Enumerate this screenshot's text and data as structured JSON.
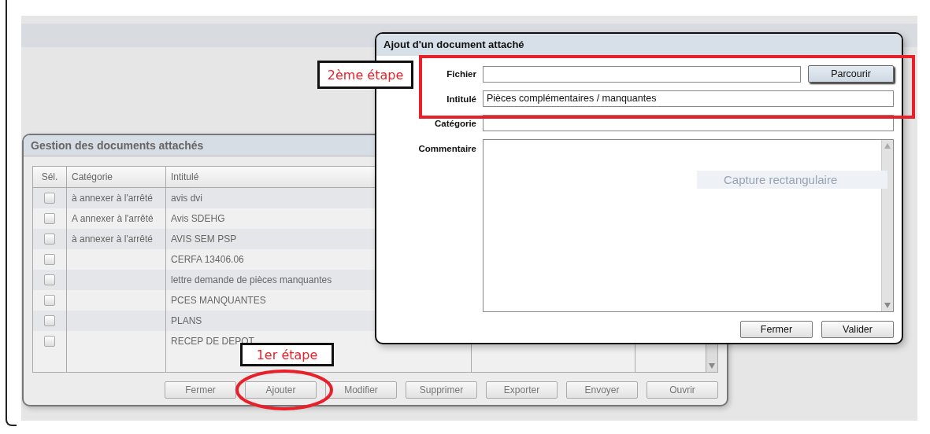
{
  "manager": {
    "title": "Gestion des documents attachés",
    "columns": [
      "Sél.",
      "Catégorie",
      "Intitulé"
    ],
    "rows": [
      {
        "checked": false,
        "category": "à annexer à l'arrêté",
        "title": "avis dvi"
      },
      {
        "checked": false,
        "category": "A annexer à  l'arrêté",
        "title": "Avis SDEHG"
      },
      {
        "checked": false,
        "category": "à annexer à l'arrêté",
        "title": "AVIS SEM PSP"
      },
      {
        "checked": false,
        "title": "CERFA 13406.06"
      },
      {
        "checked": false,
        "title": "lettre demande de pièces manquantes"
      },
      {
        "checked": false,
        "title": "PCES MANQUANTES"
      },
      {
        "checked": false,
        "title": "PLANS"
      },
      {
        "checked": false,
        "title": "RECEP DE DEPOT"
      }
    ],
    "buttons": [
      "Fermer",
      "Ajouter",
      "Modifier",
      "Supprimer",
      "Exporter",
      "Envoyer",
      "Ouvrir"
    ]
  },
  "dialog": {
    "title": "Ajout d'un document attaché",
    "fields": [
      {
        "kind": "file",
        "label": "Fichier",
        "button": "Parcourir"
      },
      {
        "kind": "input",
        "label": "Intitulé",
        "value": "Pièces complémentaires / manquantes"
      },
      {
        "kind": "input",
        "label": "Catégorie"
      },
      {
        "kind": "textarea",
        "label": "Commentaire"
      }
    ],
    "buttons": [
      "Fermer",
      "Valider"
    ]
  },
  "ghost_text": "Capture rectangulaire",
  "annotations": {
    "step_2": "2ème étape",
    "step_1": "1er étape"
  }
}
